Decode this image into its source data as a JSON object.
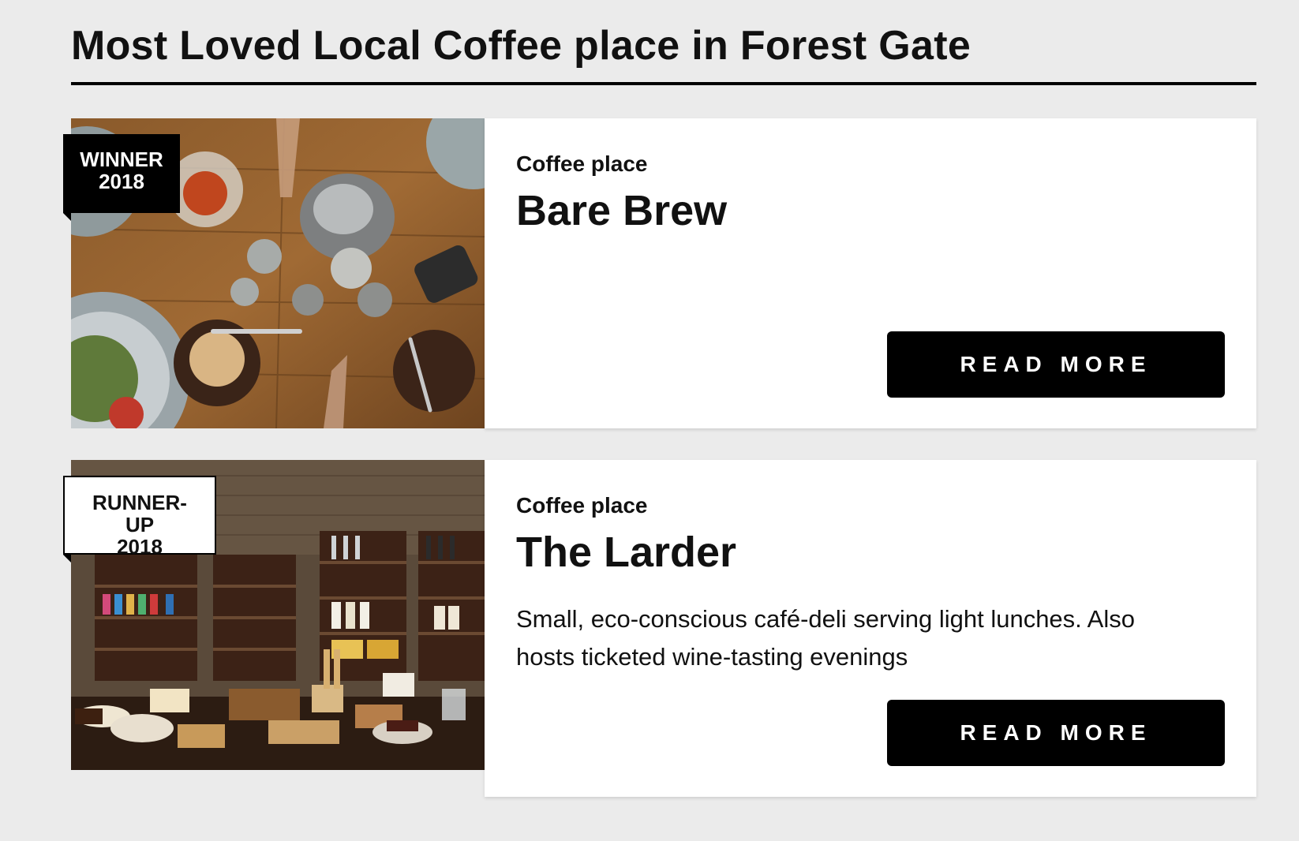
{
  "page": {
    "title": "Most Loved Local Coffee place in Forest Gate"
  },
  "cards": [
    {
      "badge_line1": "WINNER",
      "badge_line2": "2018",
      "category": "Coffee place",
      "name": "Bare Brew",
      "description": "",
      "button_label": "READ MORE",
      "image_icon": "cafe-table-photo"
    },
    {
      "badge_line1": "RUNNER-UP",
      "badge_line2": "2018",
      "category": "Coffee place",
      "name": "The Larder",
      "description": "Small, eco-conscious café-deli serving light lunches. Also hosts ticketed wine-tasting evenings",
      "button_label": "READ MORE",
      "image_icon": "deli-shelves-photo"
    }
  ],
  "colors": {
    "background": "#ebebeb",
    "button": "#000000",
    "card": "#ffffff"
  }
}
